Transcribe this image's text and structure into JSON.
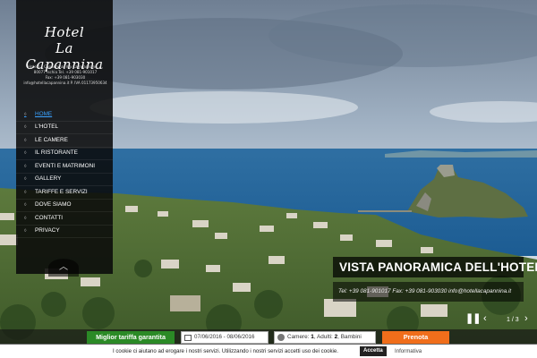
{
  "logo": {
    "line1": "Hotel",
    "line2": "La Capannina"
  },
  "address": {
    "line1": "Hotel La Capannina, Via Campagnano, 4,",
    "line2": "80077 Ischia  Tel. +39 081-901017",
    "line3": "Fax: +39 081-903030",
    "line4": "info@hotellacapannina.it  P. IVA 01173950634"
  },
  "menu": [
    {
      "label": "HOME"
    },
    {
      "label": "L'HOTEL"
    },
    {
      "label": "LE CAMERE"
    },
    {
      "label": "IL RISTORANTE"
    },
    {
      "label": "EVENTI E MATRIMONI"
    },
    {
      "label": "GALLERY"
    },
    {
      "label": "TARIFFE E SERVIZI"
    },
    {
      "label": "DOVE SIAMO"
    },
    {
      "label": "CONTATTI"
    },
    {
      "label": "PRIVACY"
    }
  ],
  "icons": {
    "up": "chevron-up-icon",
    "pause": "pause-icon",
    "prev": "chevron-left-icon",
    "next": "chevron-right-icon",
    "calendar": "calendar-icon",
    "user": "user-icon"
  },
  "slide": {
    "title": "VISTA PANORAMICA DELL'HOTEL",
    "subtitle": "Tel: +39 081-901017 Fax: +39 081-903030 info@hotellacapannina.it",
    "counter": "1 / 3"
  },
  "booking": {
    "best_rate": "Miglior tariffa garantita",
    "dates": "07/06/2016 - 08/06/2016",
    "guests_rooms_label": "Camere: ",
    "guests_rooms": "1",
    "guests_adults_label": ", Adulti: ",
    "guests_adults": "2",
    "guests_kids_label": ", Bambini",
    "book_label": "Prenota"
  },
  "cookie": {
    "text": "I cookie ci aiutano ad erogare i nostri servizi. Utilizzando i nostri servizi accetti uso dei cookie.",
    "accept": "Accetta",
    "info": "Informativa"
  },
  "colors": {
    "accent": "#3aa3ff",
    "green": "#2b8a26",
    "orange": "#f06e1b",
    "sidebar": "#0a0a0a"
  }
}
